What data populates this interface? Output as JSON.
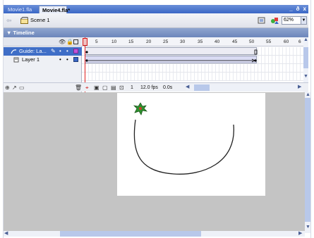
{
  "tabs": [
    {
      "label": "Movie1.fla"
    },
    {
      "label": "Movie4.fla*"
    }
  ],
  "window_controls": {
    "minimize": "_",
    "restore": "ð",
    "close": "x"
  },
  "scene": {
    "label": "Scene 1"
  },
  "zoom": {
    "value": "62%"
  },
  "timeline": {
    "title": "Timeline",
    "layers": [
      {
        "name": "Guide: La...",
        "selected": true
      },
      {
        "name": "Layer 1",
        "selected": false
      }
    ],
    "ruler": [
      "5",
      "10",
      "15",
      "20",
      "25",
      "30",
      "35",
      "40",
      "45",
      "50",
      "55",
      "60",
      "6"
    ],
    "footer": {
      "current_frame": "1",
      "frame_rate": "12.0 fps",
      "elapsed": "0.0s"
    }
  },
  "colors": {
    "selected_layer": "#3f6ec7",
    "playhead": "#e02020",
    "stage_bg": "#c4c4c4"
  }
}
